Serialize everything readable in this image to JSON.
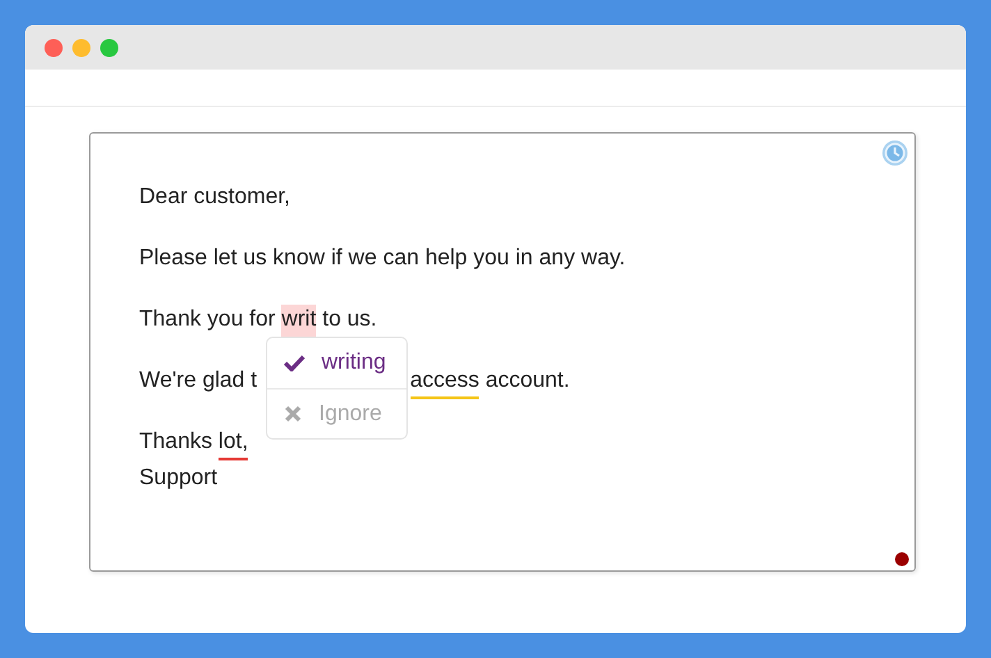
{
  "editor": {
    "paragraphs": [
      {
        "lines": [
          {
            "segments": [
              {
                "text": "Dear customer,",
                "kind": "plain"
              }
            ]
          }
        ]
      },
      {
        "lines": [
          {
            "segments": [
              {
                "text": "Please let us know if we can help you in any way.",
                "kind": "plain"
              }
            ]
          }
        ]
      },
      {
        "lines": [
          {
            "segments": [
              {
                "text": "Thank you for ",
                "kind": "plain"
              },
              {
                "text": "writ",
                "kind": "highlight"
              },
              {
                "text": " to us.",
                "kind": "plain"
              }
            ]
          }
        ]
      },
      {
        "lines": [
          {
            "obscured": true,
            "segments": [
              {
                "text": "We're glad t",
                "kind": "plain"
              },
              {
                "text": "access",
                "kind": "warning"
              },
              {
                "text": " account.",
                "kind": "plain"
              }
            ]
          }
        ]
      },
      {
        "lines": [
          {
            "segments": [
              {
                "text": "Thanks ",
                "kind": "plain"
              },
              {
                "text": "lot,",
                "kind": "error"
              }
            ]
          },
          {
            "segments": [
              {
                "text": "Support",
                "kind": "plain"
              }
            ]
          }
        ]
      }
    ],
    "status_dot": {
      "color": "#9b0000"
    }
  },
  "popup": {
    "options": [
      {
        "kind": "accept",
        "label": "writing"
      },
      {
        "kind": "ignore",
        "label": "Ignore"
      }
    ]
  }
}
